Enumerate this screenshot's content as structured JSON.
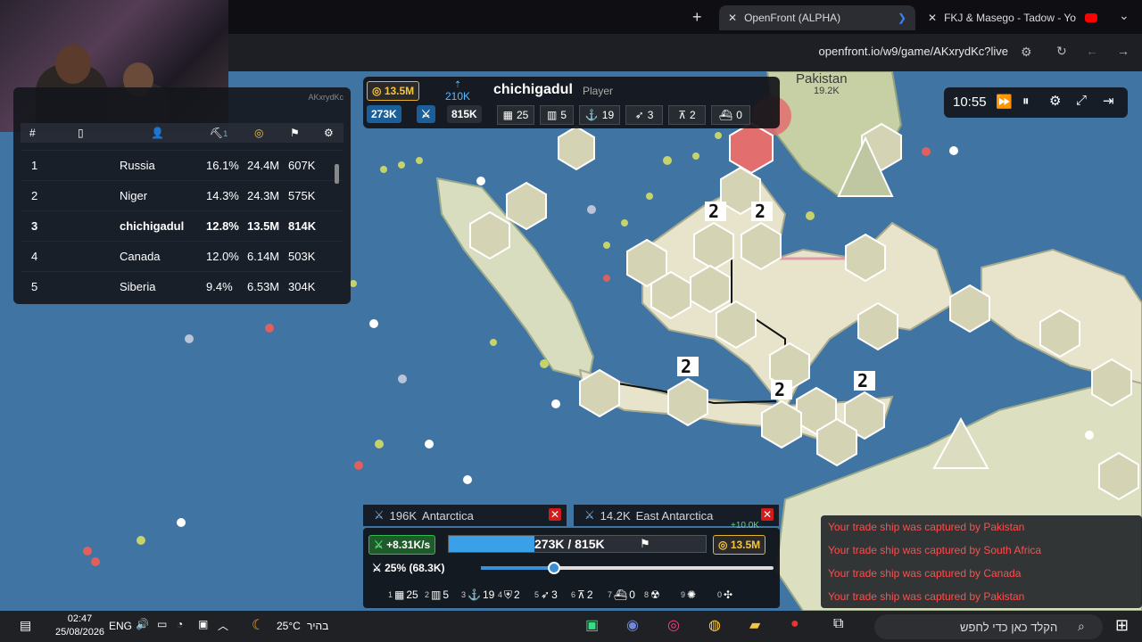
{
  "browser": {
    "tabs": [
      {
        "label": "OpenFront (ALPHA)",
        "active": true
      },
      {
        "label": "FKJ & Masego - Tadow - Yo",
        "active": false
      }
    ],
    "url": "openfront.io/w9/game/AKxrydKc?live",
    "new_tab_symbol": "+"
  },
  "leaderboard": {
    "game_code": "AKxrydKc",
    "header": {
      "rank": "#",
      "col_sort": "1"
    },
    "rows": [
      {
        "rank": "1",
        "name": "Russia",
        "territory": "16.1%",
        "gold": "24.4M",
        "troops": "607K",
        "bold": false
      },
      {
        "rank": "2",
        "name": "Niger",
        "territory": "14.3%",
        "gold": "24.3M",
        "troops": "575K",
        "bold": false
      },
      {
        "rank": "3",
        "name": "chichigadul",
        "territory": "12.8%",
        "gold": "13.5M",
        "troops": "814K",
        "bold": true
      },
      {
        "rank": "4",
        "name": "Canada",
        "territory": "12.0%",
        "gold": "6.14M",
        "troops": "503K",
        "bold": false
      },
      {
        "rank": "5",
        "name": "Siberia",
        "territory": "9.4%",
        "gold": "6.53M",
        "troops": "304K",
        "bold": false
      }
    ]
  },
  "player_bar": {
    "gold": "13.5M",
    "troop_income": "210K",
    "name": "chichigadul",
    "role": "Player",
    "troops": "273K",
    "max_troops": "815K",
    "cities": "25",
    "factories": "5",
    "ports": "19",
    "missile_silos": "3",
    "sam": "2",
    "warships": "0"
  },
  "map_labels": {
    "pakistan": "Pakistan",
    "pakistan_troops": "19.2K"
  },
  "clock": {
    "time": "10:55"
  },
  "attacks": [
    {
      "troops": "196K",
      "target": "Antarctica"
    },
    {
      "troops": "14.2K",
      "target": "East Antarctica"
    }
  ],
  "control": {
    "income_rate": "+8.31K/s",
    "troop_display": "273K / 815K",
    "troop_fraction": 0.335,
    "gold": "13.5M",
    "gold_gain": "+10.0K",
    "attack_ratio_label": "25% (68.3K)",
    "attack_ratio_fraction": 0.25,
    "build_buttons": [
      {
        "key": "1",
        "icon": "city-icon",
        "count": "25"
      },
      {
        "key": "2",
        "icon": "factory-icon",
        "count": "5"
      },
      {
        "key": "3",
        "icon": "port-icon",
        "count": "19"
      },
      {
        "key": "4",
        "icon": "defense-post-icon",
        "count": "2"
      },
      {
        "key": "5",
        "icon": "missile-silo-icon",
        "count": "3"
      },
      {
        "key": "6",
        "icon": "sam-launcher-icon",
        "count": "2"
      },
      {
        "key": "7",
        "icon": "warship-icon",
        "count": "0"
      },
      {
        "key": "8",
        "icon": "atom-bomb-icon",
        "count": ""
      },
      {
        "key": "9",
        "icon": "hydrogen-bomb-icon",
        "count": ""
      },
      {
        "key": "0",
        "icon": "mirv-icon",
        "count": ""
      }
    ]
  },
  "notifications": [
    "Your trade ship was captured by Pakistan",
    "Your trade ship was captured by South Africa",
    "Your trade ship was captured by Canada",
    "Your trade ship was captured by Pakistan"
  ],
  "taskbar": {
    "time": "02:47",
    "date": "25/08/2026",
    "language": "ENG",
    "weather": "25°C",
    "weather_text": "בהיר",
    "search_placeholder": "הקלד כאן כדי לחפש"
  }
}
